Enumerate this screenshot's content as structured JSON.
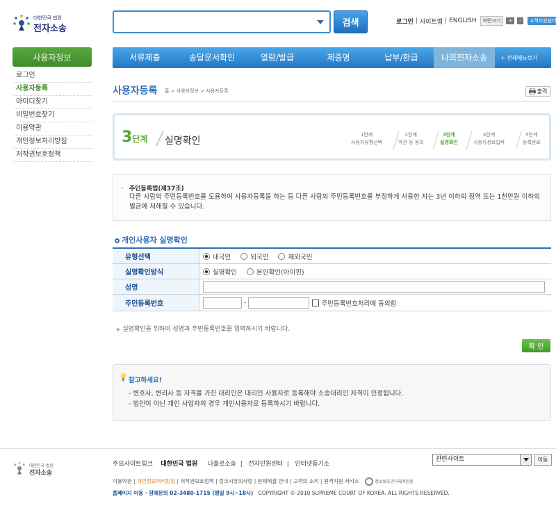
{
  "header": {
    "logo_small": "대한민국 법원",
    "logo_big": "전자소송",
    "search_placeholder": "",
    "search_button": "검색",
    "links": [
      "로그인",
      "사이트맵",
      "ENGLISH"
    ],
    "zoom_label": "화면크기",
    "zoom_plus": "+",
    "zoom_minus": "-",
    "customer_center": "고객지원센터"
  },
  "sidebar": {
    "title": "사용자정보",
    "items": [
      {
        "label": "로그인",
        "active": false
      },
      {
        "label": "사용자등록",
        "active": true
      },
      {
        "label": "아이디찾기",
        "active": false
      },
      {
        "label": "비밀번호찾기",
        "active": false
      },
      {
        "label": "이용약관",
        "active": false
      },
      {
        "label": "개인정보처리방침",
        "active": false
      },
      {
        "label": "저작권보호정책",
        "active": false
      }
    ]
  },
  "nav": {
    "items": [
      "서류제출",
      "송달문서확인",
      "열람/발급",
      "제증명",
      "납부/환급",
      "나의전자소송"
    ],
    "active": "나의전자소송",
    "all_menu": "+ 전체메뉴보기"
  },
  "page": {
    "title": "사용자등록",
    "breadcrumb": "홈 > 사용자정보 > 사용자등록",
    "print": "출력"
  },
  "steps": {
    "current_number": "3",
    "current_suffix": "단계",
    "current_title": "실명확인",
    "list": [
      {
        "n": "1단계",
        "t": "사용자유형선택",
        "active": false
      },
      {
        "n": "2단계",
        "t": "약관 등 동의",
        "active": false
      },
      {
        "n": "3단계",
        "t": "실명확인",
        "active": true
      },
      {
        "n": "4단계",
        "t": "사용자정보입력",
        "active": false
      },
      {
        "n": "5단계",
        "t": "등록완료",
        "active": false
      }
    ]
  },
  "notice": {
    "title": "주민등록법(제37조)",
    "body": "다른 사람의 주민등록번호를 도용하여 사용자등록을 하는 등 다른 사람의 주민등록번호를 부정하게 사용한 자는 3년 이하의 징역 또는 1천만원 이하의 벌금에 처해질 수 있습니다."
  },
  "form": {
    "section_title": "개인사용자 실명확인",
    "type_label": "유형선택",
    "type_options": [
      "내국인",
      "외국인",
      "재외국민"
    ],
    "type_selected": "내국인",
    "method_label": "실명확인방식",
    "method_options": [
      "실명확인",
      "본인확인(아이핀)"
    ],
    "method_selected": "실명확인",
    "name_label": "성명",
    "name_value": "",
    "rrn_label": "주민등록번호",
    "rrn_front": "",
    "rrn_back": "",
    "rrn_dash": "-",
    "rrn_agree": "주민등록번호처리에 동의함",
    "hint": "실명확인을 위하여 성명과 주민등록번호를 입력하시기 바랍니다.",
    "confirm_button": "확 인"
  },
  "note": {
    "title": "참고하세요!",
    "lines": [
      "- 변호사, 변리사 등 자격을 가진 대리인은 대리인 사용자로 등록해야 소송대리인 자격이 인정됩니다.",
      "- 법인이 아닌 개인 사업자의 경우 개인사용자로 등록하시기 바랍니다."
    ]
  },
  "footer": {
    "logo_small": "대한민국 법원",
    "logo_big": "전자소송",
    "site_links_label": "주요사이트링크",
    "site_links": [
      "대한민국 법원",
      "나홀로소송",
      "전자민원센터",
      "인터넷등기소"
    ],
    "related_select": "관련사이트",
    "move_button": "이동",
    "bottom_links": [
      "이용약관",
      "개인정보처리방침",
      "저작권보호정책",
      "링크시유의사항",
      "문제해결 안내",
      "고객의 소리",
      "원격지원 서비스"
    ],
    "cert_mark": "정보보호관리체계인증",
    "contact": "홈페이지 이용 · 장애문의 02-3480-1715 (평일 9시~18시)",
    "copyright": "COPYRIGHT © 2010 SUPREME COURT OF KOREA. ALL RIGHTS RESERVED."
  },
  "colors": {
    "nav_blue": "#2f86d4",
    "green": "#5aa63a",
    "title_blue": "#2f6fb5",
    "orange": "#e99a2a"
  }
}
